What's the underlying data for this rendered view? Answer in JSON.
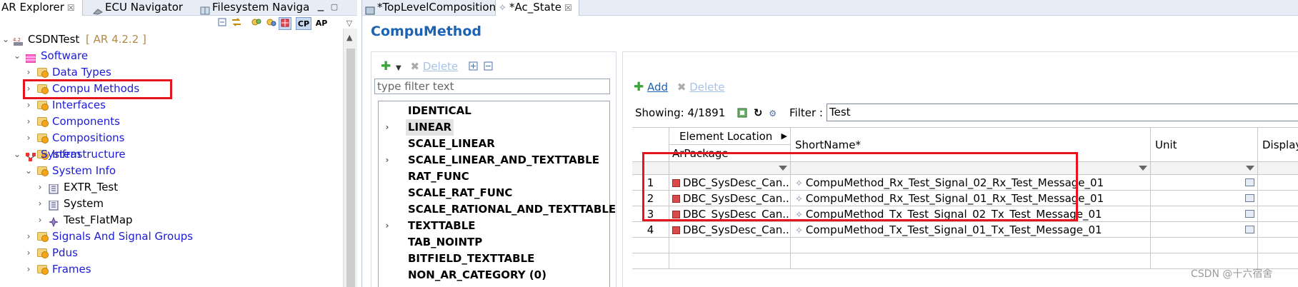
{
  "left_panel": {
    "tabs": [
      {
        "label": "AR Explorer",
        "close": "☒"
      },
      {
        "label": "ECU Navigator"
      },
      {
        "label": "Filesystem Naviga"
      }
    ],
    "toolbar": {
      "cp": "CP",
      "ap": "AP"
    },
    "tree": {
      "root": {
        "label": "CSDNTest",
        "version": "[ AR 4.2.2 ]"
      },
      "software": "Software",
      "software_children": [
        "Data Types",
        "Compu Methods",
        "Interfaces",
        "Components",
        "Compositions",
        "Infrastructure"
      ],
      "system": "System",
      "system_info": "System Info",
      "system_info_children": [
        "EXTR_Test",
        "System",
        "Test_FlatMap"
      ],
      "more": [
        "Signals And Signal Groups",
        "Pdus",
        "Frames"
      ]
    },
    "highlight_item": "Compu Methods"
  },
  "editor": {
    "tabs": [
      {
        "label": "*TopLevelComposition"
      },
      {
        "label": "*Ac_State",
        "close": "☒"
      }
    ],
    "title": "CompuMethod",
    "left_toolbar": {
      "delete": "Delete"
    },
    "type_filter_placeholder": "type filter text",
    "categories": [
      {
        "label": "IDENTICAL",
        "expandable": false
      },
      {
        "label": "LINEAR",
        "expandable": true,
        "selected": true
      },
      {
        "label": "SCALE_LINEAR",
        "expandable": false
      },
      {
        "label": "SCALE_LINEAR_AND_TEXTTABLE",
        "expandable": true
      },
      {
        "label": "RAT_FUNC",
        "expandable": false
      },
      {
        "label": "SCALE_RAT_FUNC",
        "expandable": false
      },
      {
        "label": "SCALE_RATIONAL_AND_TEXTTABLE",
        "expandable": false
      },
      {
        "label": "TEXTTABLE",
        "expandable": true
      },
      {
        "label": "TAB_NOINTP",
        "expandable": false
      },
      {
        "label": "BITFIELD_TEXTTABLE",
        "expandable": false
      },
      {
        "label": "NON_AR_CATEGORY (0)",
        "expandable": false
      }
    ],
    "add_label": "Add",
    "delete_label": "Delete",
    "showing": "Showing: 4/1891",
    "filter_label": "Filter :",
    "filter_value": "Test",
    "grid": {
      "col_element_location": "Element Location",
      "col_arpackage": "ArPackage",
      "col_shortname": "ShortName*",
      "col_unit": "Unit",
      "col_display": "DisplayFo",
      "rows": [
        {
          "num": "1",
          "pkg": "DBC_SysDesc_Can...",
          "name": "CompuMethod_Rx_Test_Signal_02_Rx_Test_Message_01"
        },
        {
          "num": "2",
          "pkg": "DBC_SysDesc_Can...",
          "name": "CompuMethod_Rx_Test_Signal_01_Rx_Test_Message_01"
        },
        {
          "num": "3",
          "pkg": "DBC_SysDesc_Can...",
          "name": "CompuMethod_Tx_Test_Signal_02_Tx_Test_Message_01"
        },
        {
          "num": "4",
          "pkg": "DBC_SysDesc_Can...",
          "name": "CompuMethod_Tx_Test_Signal_01_Tx_Test_Message_01"
        }
      ]
    }
  },
  "watermark": "CSDN @十六宿舍",
  "colors": {
    "accent": "#1b63b5",
    "link": "#1c1cd6",
    "highlight": "#e8141b"
  }
}
